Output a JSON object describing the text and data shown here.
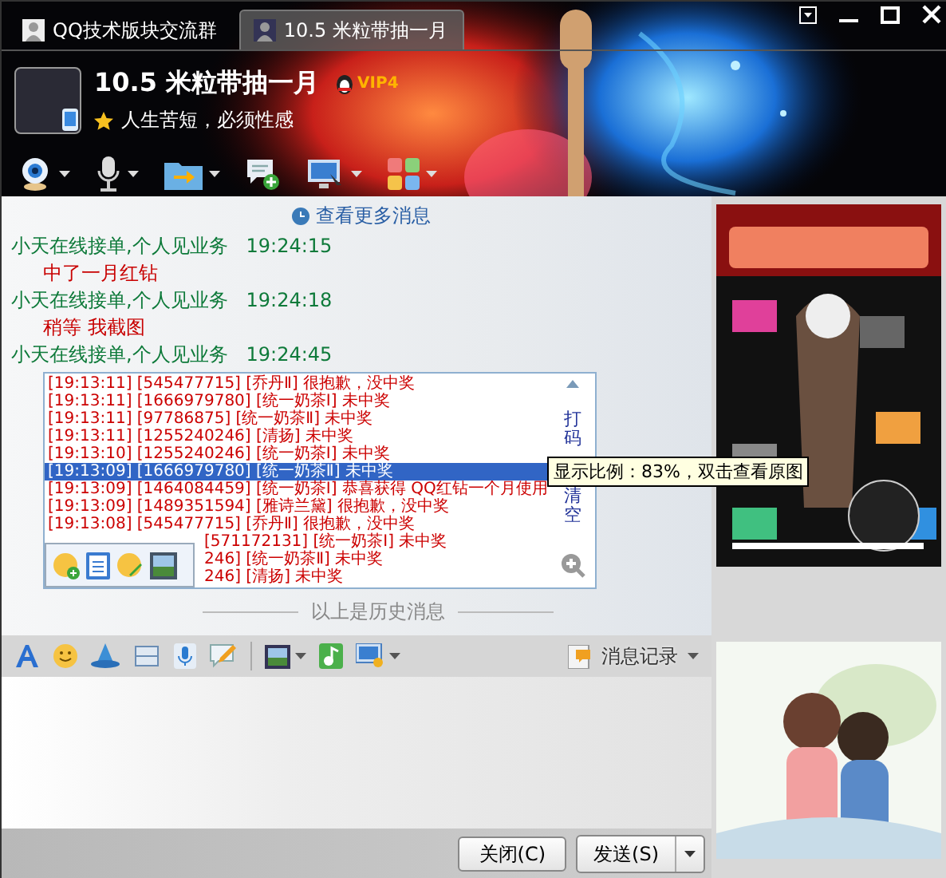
{
  "tabs": [
    {
      "label": "QQ技术版块交流群",
      "selected": false
    },
    {
      "label": "10.5 米粒带抽一月",
      "selected": true
    }
  ],
  "contact": {
    "name": "10.5 米粒带抽一月",
    "vip": "VIP4",
    "signature": "人生苦短，必须性感"
  },
  "toolbar": [
    {
      "kind": "camera",
      "dropdown": true
    },
    {
      "kind": "microphone",
      "dropdown": true
    },
    {
      "kind": "folder",
      "dropdown": true
    },
    {
      "kind": "chat-add",
      "dropdown": false
    },
    {
      "kind": "monitor",
      "dropdown": true
    },
    {
      "kind": "apps",
      "dropdown": true
    }
  ],
  "history_link": "查看更多消息",
  "messages": [
    {
      "kind": "text",
      "sender": "小天在线接单,个人见业务",
      "time": "19:24:15",
      "text": "中了一月红钻"
    },
    {
      "kind": "text",
      "sender": "小天在线接单,个人见业务",
      "time": "19:24:18",
      "text": "稍等 我截图"
    },
    {
      "sender": "小天在线接单,个人见业务",
      "time": "19:24:45"
    }
  ],
  "screenshot": {
    "lines": [
      {
        "text": "[19:13:11] [545477715] [乔丹Ⅱ] 很抱歉，没中奖",
        "selected": false,
        "kind": "full"
      },
      {
        "text": "[19:13:11] [1666979780] [统一奶茶Ⅰ] 未中奖",
        "selected": false,
        "kind": "full"
      },
      {
        "text": "[19:13:11] [97786875] [统一奶茶Ⅱ] 未中奖",
        "selected": false,
        "kind": "full"
      },
      {
        "text": "[19:13:11] [1255240246] [清扬] 未中奖",
        "selected": false,
        "kind": "full"
      },
      {
        "text": "[19:13:10] [1255240246] [统一奶茶Ⅰ] 未中奖",
        "selected": false,
        "kind": "full"
      },
      {
        "text": "[19:13:09] [1666979780] [统一奶茶Ⅱ] 未中奖",
        "selected": true,
        "kind": "full"
      },
      {
        "text": "[19:13:09] [1464084459] [统一奶茶Ⅰ] 恭喜获得 QQ红钻一个月使用",
        "selected": false,
        "kind": "full"
      },
      {
        "text": "[19:13:09] [1489351594] [雅诗兰黛] 很抱歉，没中奖",
        "selected": false,
        "kind": "full"
      },
      {
        "text": "[19:13:08] [545477715] [乔丹Ⅱ] 很抱歉，没中奖",
        "selected": false,
        "kind": "full"
      },
      {
        "text": "[571172131] [统一奶茶Ⅰ] 未中奖",
        "selected": false,
        "kind": "covered"
      },
      {
        "text": "246] [统一奶茶Ⅱ] 未中奖",
        "selected": false,
        "kind": "covered"
      },
      {
        "text": "246] [清扬] 未中奖",
        "selected": false,
        "kind": "covered"
      }
    ],
    "side_labels": [
      "打码",
      "清空"
    ],
    "tooltip": "显示比例：83%，双击查看原图"
  },
  "history_divider": "以上是历史消息",
  "input_tools": [
    {
      "kind": "font",
      "dropdown": false
    },
    {
      "kind": "smiley",
      "dropdown": false
    },
    {
      "kind": "hat",
      "dropdown": false
    },
    {
      "kind": "screen",
      "dropdown": false
    },
    {
      "kind": "mic",
      "dropdown": false
    },
    {
      "kind": "note",
      "dropdown": false
    },
    {
      "kind": "divider"
    },
    {
      "kind": "picture",
      "dropdown": true
    },
    {
      "kind": "music",
      "dropdown": false
    },
    {
      "kind": "monitor",
      "dropdown": true
    }
  ],
  "history_button": "消息记录",
  "buttons": {
    "close": "关闭(C)",
    "send": "发送(S)"
  }
}
